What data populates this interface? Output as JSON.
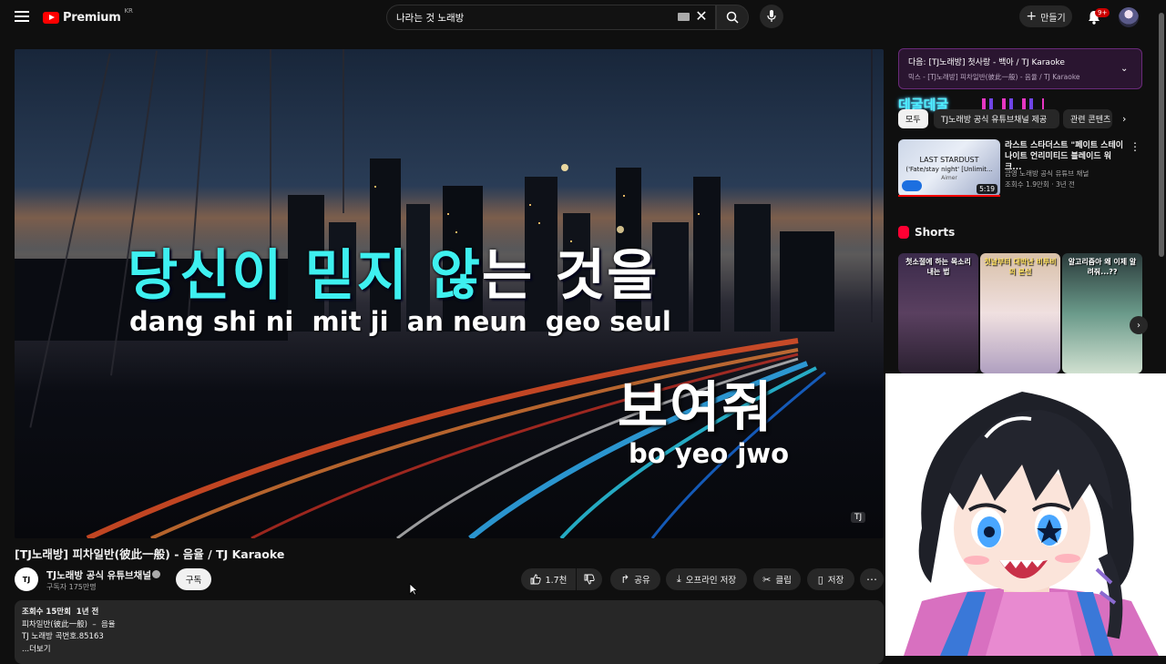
{
  "topbar": {
    "logo_text": "Premium",
    "logo_region": "KR",
    "search_value": "나라는 것 노래방",
    "create_label": "만들기",
    "notification_count": "9+"
  },
  "player": {
    "lyric_line1_sung": "당신이 믿지 않",
    "lyric_line1_rest": "는 것을",
    "roman_line1": "dang shi ni  mit ji  an neun  geo seul",
    "lyric_line2": "보여줘",
    "roman_line2": "bo yeo jwo",
    "watermark": "TJ"
  },
  "video": {
    "title": "[TJ노래방] 피차일반(彼此一般) - 음율 / TJ Karaoke",
    "channel_name": "TJ노래방 공식 유튜브채널",
    "channel_logo": "TJ",
    "subscribers": "구독자 175만명",
    "subscribe_label": "구독",
    "like_count": "1.7천",
    "share_label": "공유",
    "offline_label": "오프라인 저장",
    "clip_label": "클립",
    "save_label": "저장"
  },
  "description": {
    "line1": "조회수 15만회  1년 전",
    "line2": "피차일반(彼此一般)  –  음율",
    "line3": "TJ 노래방 곡번호.85163",
    "more": "...더보기"
  },
  "sidebar": {
    "next_title": "다음: [TJ노래방] 첫사랑 - 백아 / TJ Karaoke",
    "next_subtitle": "믹스 - [TJ노래방] 피차일반(彼此一般) - 음율 / TJ Karaoke",
    "overlay_text": "데굴데굴",
    "chips": [
      "모두",
      "TJ노래방 공식 유튜브채널 제공",
      "관련 콘텐츠"
    ],
    "rec": {
      "thumb_line1": "LAST STARDUST",
      "thumb_line2": "('Fate/stay night' [Unlimit...",
      "thumb_line3": "Aimer",
      "duration": "5:19",
      "title": "라스트 스타더스트 \"페이트 스테이 나이트 언리미티드 블레이드 워크...",
      "channel": "금영 노래방 공식 유튜브 채널",
      "meta": "조회수 1.9만회 · 3년 전"
    },
    "shorts_heading": "Shorts",
    "shorts": [
      {
        "caption": "첫소절에 하는 목소리 내는 법"
      },
      {
        "caption": "첫날부터 대박난 비투비의 본선"
      },
      {
        "caption": "알고리즘아 왜 이제 알려줘...??"
      }
    ]
  },
  "colors": {
    "accent_red": "#ff0000",
    "lyric_cyan": "#3ef0f0",
    "next_box_bg": "#2a1530"
  }
}
